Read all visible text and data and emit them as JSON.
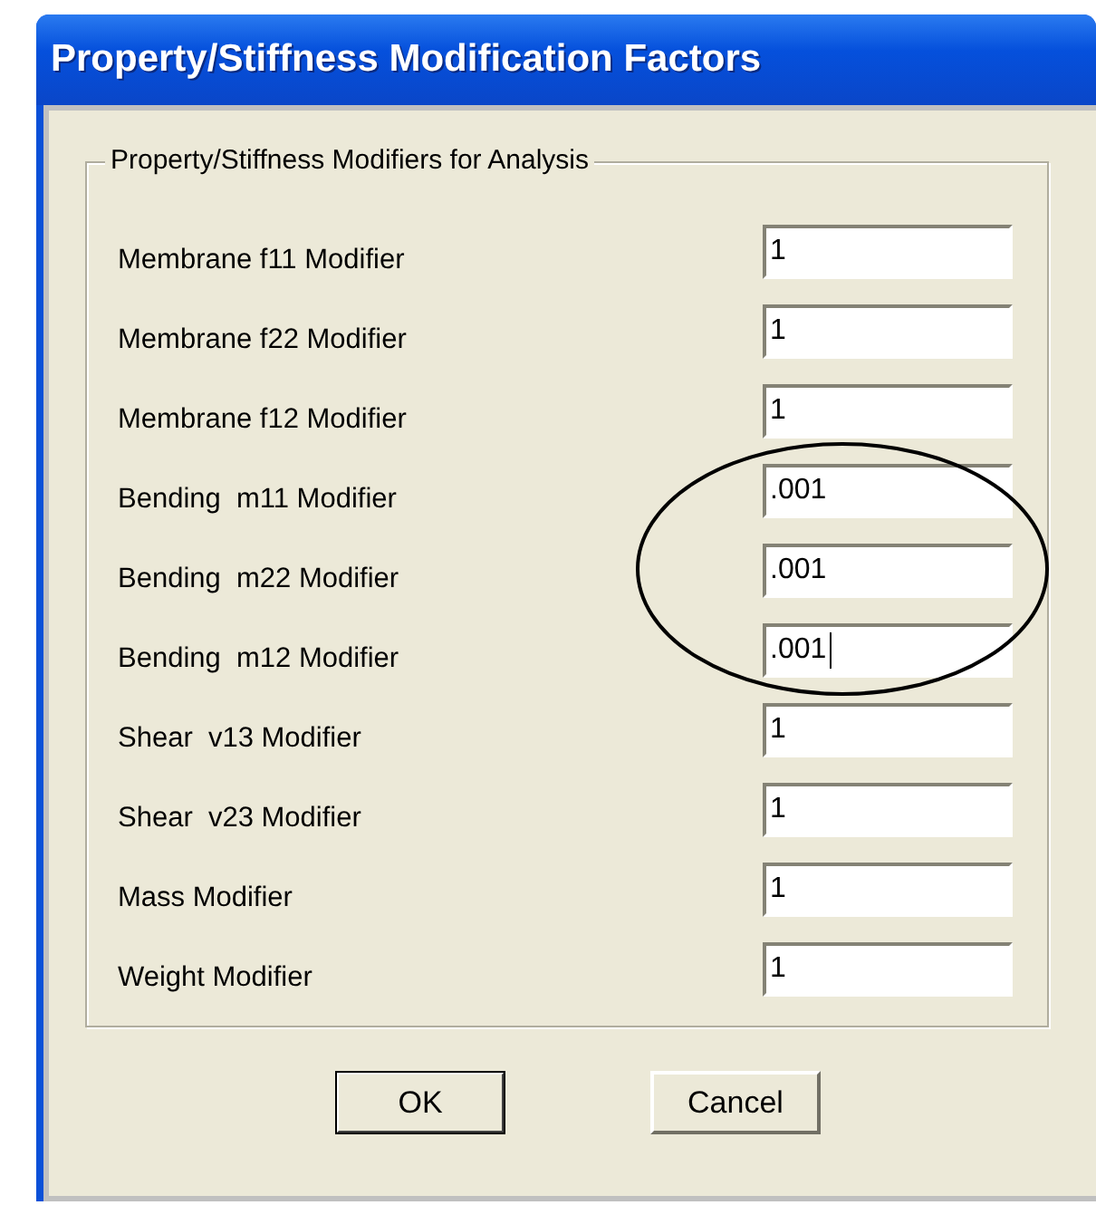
{
  "window": {
    "title": "Property/Stiffness Modification Factors"
  },
  "group": {
    "title": "Property/Stiffness Modifiers for Analysis"
  },
  "fields": [
    {
      "label": "Membrane f11 Modifier",
      "value": "1",
      "focused": false
    },
    {
      "label": "Membrane f22 Modifier",
      "value": "1",
      "focused": false
    },
    {
      "label": "Membrane f12 Modifier",
      "value": "1",
      "focused": false
    },
    {
      "label": "Bending  m11 Modifier",
      "value": ".001",
      "focused": false
    },
    {
      "label": "Bending  m22 Modifier",
      "value": ".001",
      "focused": false
    },
    {
      "label": "Bending  m12 Modifier",
      "value": ".001",
      "focused": true
    },
    {
      "label": "Shear  v13 Modifier",
      "value": "1",
      "focused": false
    },
    {
      "label": "Shear  v23 Modifier",
      "value": "1",
      "focused": false
    },
    {
      "label": "Mass Modifier",
      "value": "1",
      "focused": false
    },
    {
      "label": "Weight Modifier",
      "value": "1",
      "focused": false
    }
  ],
  "buttons": [
    {
      "label": "OK",
      "default": true
    },
    {
      "label": "Cancel",
      "default": false
    }
  ]
}
